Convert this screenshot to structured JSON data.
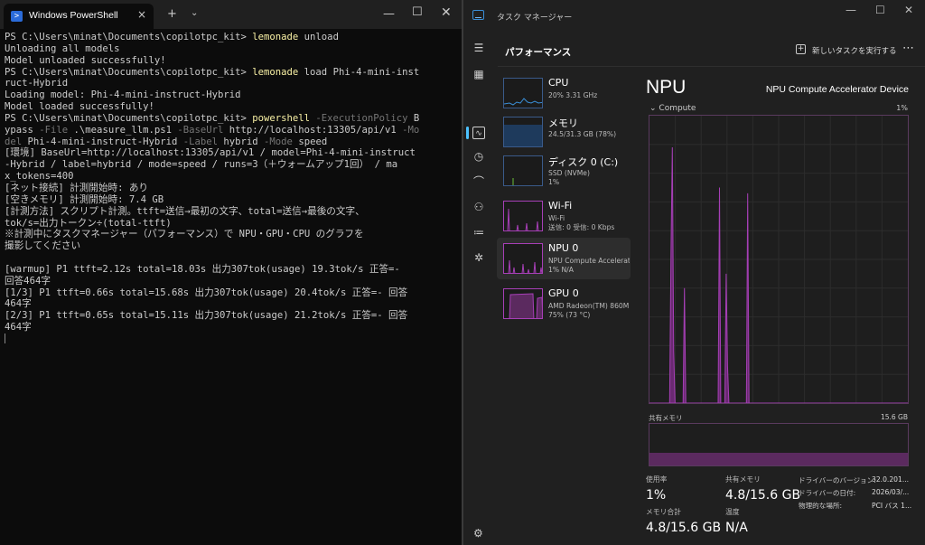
{
  "powershell": {
    "tab_title": "Windows PowerShell",
    "new_tab_label": "+",
    "dropdown_label": "⌄",
    "lines": [
      [
        {
          "t": "PS C:\\Users\\minat\\Documents\\copilotpc_kit> "
        },
        {
          "t": "lemonade",
          "c": "cmd"
        },
        {
          "t": " unload"
        }
      ],
      [
        {
          "t": "Unloading all models"
        }
      ],
      [
        {
          "t": "Model unloaded successfully!"
        }
      ],
      [
        {
          "t": "PS C:\\Users\\minat\\Documents\\copilotpc_kit> "
        },
        {
          "t": "lemonade",
          "c": "cmd"
        },
        {
          "t": " load Phi-4-mini-inst"
        }
      ],
      [
        {
          "t": "ruct-Hybrid"
        }
      ],
      [
        {
          "t": "Loading model: Phi-4-mini-instruct-Hybrid"
        }
      ],
      [
        {
          "t": "Model loaded successfully!"
        }
      ],
      [
        {
          "t": "PS C:\\Users\\minat\\Documents\\copilotpc_kit> "
        },
        {
          "t": "powershell",
          "c": "cmd"
        },
        {
          "t": " -ExecutionPolicy",
          "c": "par"
        },
        {
          "t": " B"
        }
      ],
      [
        {
          "t": "ypass "
        },
        {
          "t": "-File",
          "c": "par"
        },
        {
          "t": " .\\measure_llm.ps1 "
        },
        {
          "t": "-BaseUrl",
          "c": "par"
        },
        {
          "t": " http://localhost:13305/api/v1 "
        },
        {
          "t": "-Mo",
          "c": "par"
        }
      ],
      [
        {
          "t": "del",
          "c": "par"
        },
        {
          "t": " Phi-4-mini-instruct-Hybrid "
        },
        {
          "t": "-Label",
          "c": "par"
        },
        {
          "t": " hybrid "
        },
        {
          "t": "-Mode",
          "c": "par"
        },
        {
          "t": " speed"
        }
      ],
      [
        {
          "t": "[環境] BaseUrl=http://localhost:13305/api/v1 / model=Phi-4-mini-instruct"
        }
      ],
      [
        {
          "t": "-Hybrid / label=hybrid / mode=speed / runs=3（＋ウォームアップ1回） / ma"
        }
      ],
      [
        {
          "t": "x_tokens=400"
        }
      ],
      [
        {
          "t": "[ネット接続] 計測開始時: あり"
        }
      ],
      [
        {
          "t": "[空きメモリ] 計測開始時: 7.4 GB"
        }
      ],
      [
        {
          "t": "[計測方法] スクリプト計測。ttft=送信→最初の文字、total=送信→最後の文字、"
        }
      ],
      [
        {
          "t": "tok/s=出力トークン÷(total-ttft)"
        }
      ],
      [
        {
          "t": "※計測中にタスクマネージャー（パフォーマンス）で NPU・GPU・CPU のグラフを"
        }
      ],
      [
        {
          "t": "撮影してください"
        }
      ],
      [
        {
          "t": ""
        }
      ],
      [
        {
          "t": "[warmup] P1 ttft=2.12s total=18.03s 出力307tok(usage) 19.3tok/s 正答=- "
        }
      ],
      [
        {
          "t": "回答464字"
        }
      ],
      [
        {
          "t": "[1/3] P1 ttft=0.66s total=15.68s 出力307tok(usage) 20.4tok/s 正答=- 回答"
        }
      ],
      [
        {
          "t": "464字"
        }
      ],
      [
        {
          "t": "[2/3] P1 ttft=0.65s total=15.11s 出力307tok(usage) 21.2tok/s 正答=- 回答"
        }
      ],
      [
        {
          "t": "464字"
        }
      ]
    ]
  },
  "taskmanager": {
    "title": "タスク マネージャー",
    "section_title": "パフォーマンス",
    "run_new_task": "新しいタスクを実行する",
    "more_label": "⋯",
    "items": [
      {
        "name": "CPU",
        "sub1": "20% 3.31 GHz",
        "sub2": "",
        "thumb": "cpu-line"
      },
      {
        "name": "メモリ",
        "sub1": "24.5/31.3 GB (78%)",
        "sub2": "",
        "thumb": "memory-fill"
      },
      {
        "name": "ディスク 0 (C:)",
        "sub1": "SSD (NVMe)",
        "sub2": "1%",
        "thumb": "disk-blip"
      },
      {
        "name": "Wi-Fi",
        "sub1": "Wi-Fi",
        "sub2": "送信: 0 受信: 0 Kbps",
        "thumb": "wifi-spikes"
      },
      {
        "name": "NPU 0",
        "sub1": "NPU Compute Accelerator Device",
        "sub2": "1% N/A",
        "thumb": "npu-spikes"
      },
      {
        "name": "GPU 0",
        "sub1": "AMD Radeon(TM) 860M",
        "sub2": "75% (73 °C)",
        "thumb": "gpu-block"
      }
    ],
    "detail": {
      "title": "NPU",
      "device": "NPU Compute Accelerator Device",
      "compute_label": "Compute",
      "compute_pct": "1%",
      "shared_memory_label": "共有メモリ",
      "shared_memory_max": "15.6 GB",
      "shared_memory_used_fraction": 0.31,
      "npu_graph_series": [
        0,
        0,
        0,
        0,
        0,
        0,
        0,
        0,
        0,
        0,
        0,
        0,
        0,
        0,
        0,
        0,
        52,
        89,
        18,
        0,
        0,
        0,
        0,
        0,
        0,
        0,
        40,
        0,
        0,
        0,
        0,
        0,
        0,
        0,
        0,
        0,
        0,
        0,
        0,
        0,
        0,
        0,
        0,
        0,
        0,
        0,
        0,
        0,
        0,
        0,
        0,
        0,
        75,
        0,
        0,
        0,
        0,
        45,
        13,
        0,
        0,
        0,
        0,
        0,
        0,
        0,
        0,
        0,
        0,
        0,
        0,
        0,
        0,
        73,
        0,
        0,
        0,
        0,
        0,
        0,
        0,
        0,
        0,
        0,
        0,
        0,
        0,
        0,
        0,
        0,
        0,
        0,
        0,
        0,
        0,
        0,
        0,
        0,
        0,
        0,
        0,
        0,
        0,
        0,
        0,
        0,
        0,
        0,
        0,
        0,
        0,
        0,
        0,
        0,
        0,
        0,
        0,
        0,
        0,
        0,
        0,
        0,
        0,
        0,
        0,
        0,
        0,
        0,
        0,
        0,
        0,
        0,
        0,
        0,
        0,
        0,
        0,
        0,
        0,
        0,
        0,
        0,
        0,
        0,
        0,
        0,
        0,
        0,
        0,
        0,
        0,
        0,
        0,
        0,
        0,
        0,
        0,
        0,
        0,
        0,
        0,
        0,
        0,
        0,
        0,
        0,
        0,
        0,
        0,
        0,
        0,
        0,
        0,
        0,
        0,
        0,
        0,
        0,
        0,
        0,
        0,
        0,
        0,
        0,
        0,
        0,
        0,
        0,
        0,
        0,
        0,
        0,
        0
      ],
      "stats": [
        {
          "label": "使用率",
          "value": "1%"
        },
        {
          "label": "共有メモリ",
          "value": "4.8/15.6 GB"
        },
        {
          "label": "メモリ合計",
          "value": "4.8/15.6 GB"
        },
        {
          "label": "温度",
          "value": "N/A"
        }
      ],
      "driver": [
        {
          "label": "ドライバーのバージョン:",
          "value": "32.0.201..."
        },
        {
          "label": "ドライバーの日付:",
          "value": "2026/03/..."
        },
        {
          "label": "物理的な場所:",
          "value": "PCI バス 1..."
        }
      ]
    },
    "colors": {
      "npu": "#a63fb6",
      "cpu": "#3a8fd8",
      "accent": "#4cc2ff"
    }
  }
}
